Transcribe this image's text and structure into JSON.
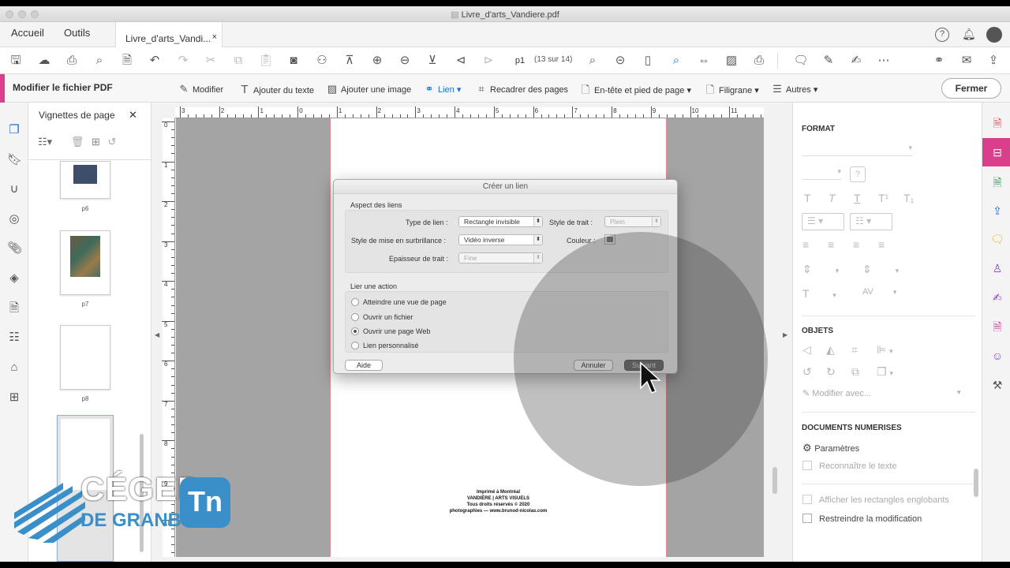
{
  "window": {
    "title": "Livre_d'arts_Vandiere.pdf"
  },
  "menu": {
    "home": "Accueil",
    "tools": "Outils",
    "doc_tab": "Livre_d'arts_Vandi...",
    "doc_tab_close": "×"
  },
  "toolbar": {
    "page_field": "p1",
    "page_count": "(13 sur 14)"
  },
  "editbar": {
    "title": "Modifier le fichier PDF",
    "modify": "Modifier",
    "add_text": "Ajouter du texte",
    "add_image": "Ajouter une image",
    "link": "Lien",
    "crop": "Recadrer des pages",
    "header_footer": "En-tête et pied de page",
    "watermark": "Filigrane",
    "more": "Autres",
    "close": "Fermer",
    "accent": "#d93f8a"
  },
  "thumbs": {
    "title": "Vignettes de page",
    "close": "✕",
    "labels": [
      "p6",
      "p7",
      "p8"
    ]
  },
  "ruler": {
    "h": [
      "3",
      "2",
      "1",
      "0",
      "1",
      "2",
      "3",
      "4",
      "5",
      "6",
      "7",
      "8",
      "9",
      "10",
      "11"
    ],
    "v": [
      "0",
      "1",
      "2",
      "3",
      "4",
      "5",
      "6",
      "7",
      "8",
      "9",
      "10"
    ]
  },
  "page": {
    "lines": [
      "Imprimé à Montréal",
      "VANDIÈRE | ARTS VISUELS",
      "Tous droits réservés © 2020",
      "photographies — www.brunod-nicolas.com"
    ]
  },
  "right": {
    "format": "FORMAT",
    "objects": "OBJETS",
    "modify_with": "Modifier avec...",
    "scanned": "DOCUMENTS NUMERISES",
    "settings": "Paramètres",
    "recognize": "Reconnaître le texte",
    "show_boxes": "Afficher les rectangles englobants",
    "restrict": "Restreindre la modification"
  },
  "dialog": {
    "title": "Créer un lien",
    "appearance": "Aspect des liens",
    "link_type_label": "Type de lien :",
    "link_type_value": "Rectangle invisible",
    "line_style_label": "Style de trait :",
    "line_style_value": "Plein",
    "highlight_label": "Style de mise en surbrillance :",
    "highlight_value": "Vidéo inverse",
    "color_label": "Couleur :",
    "thickness_label": "Epaisseur de trait :",
    "thickness_value": "Fine",
    "action": "Lier une action",
    "options": [
      "Atteindre une vue de page",
      "Ouvrir un fichier",
      "Ouvrir une page Web",
      "Lien personnalisé"
    ],
    "selected_option": 2,
    "help": "Aide",
    "cancel": "Annuler",
    "next": "Suivant"
  },
  "logo": {
    "line1": "CÉGEP",
    "line2": "DE GRANBY",
    "badge": "Tn",
    "brand": "#3a8fc9"
  }
}
